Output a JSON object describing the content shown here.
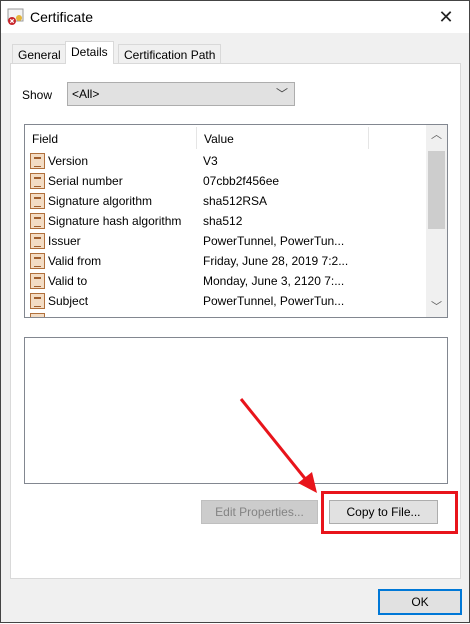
{
  "window": {
    "title": "Certificate",
    "close_icon": "close-icon"
  },
  "tabs": [
    {
      "label": "General"
    },
    {
      "label": "Details",
      "active": true
    },
    {
      "label": "Certification Path"
    }
  ],
  "show": {
    "label": "Show",
    "value": "<All>"
  },
  "list": {
    "columns": [
      "Field",
      "Value"
    ],
    "rows": [
      {
        "field": "Version",
        "value": "V3"
      },
      {
        "field": "Serial number",
        "value": "07cbb2f456ee"
      },
      {
        "field": "Signature algorithm",
        "value": "sha512RSA"
      },
      {
        "field": "Signature hash algorithm",
        "value": "sha512"
      },
      {
        "field": "Issuer",
        "value": "PowerTunnel, PowerTun..."
      },
      {
        "field": "Valid from",
        "value": "Friday, June 28, 2019 7:2..."
      },
      {
        "field": "Valid to",
        "value": "Monday, June 3, 2120 7:..."
      },
      {
        "field": "Subject",
        "value": "PowerTunnel, PowerTun..."
      }
    ]
  },
  "buttons": {
    "edit_properties": "Edit Properties...",
    "copy_to_file": "Copy to File...",
    "ok": "OK"
  },
  "annotation_color": "#e8141b",
  "accent": "#0078d7"
}
